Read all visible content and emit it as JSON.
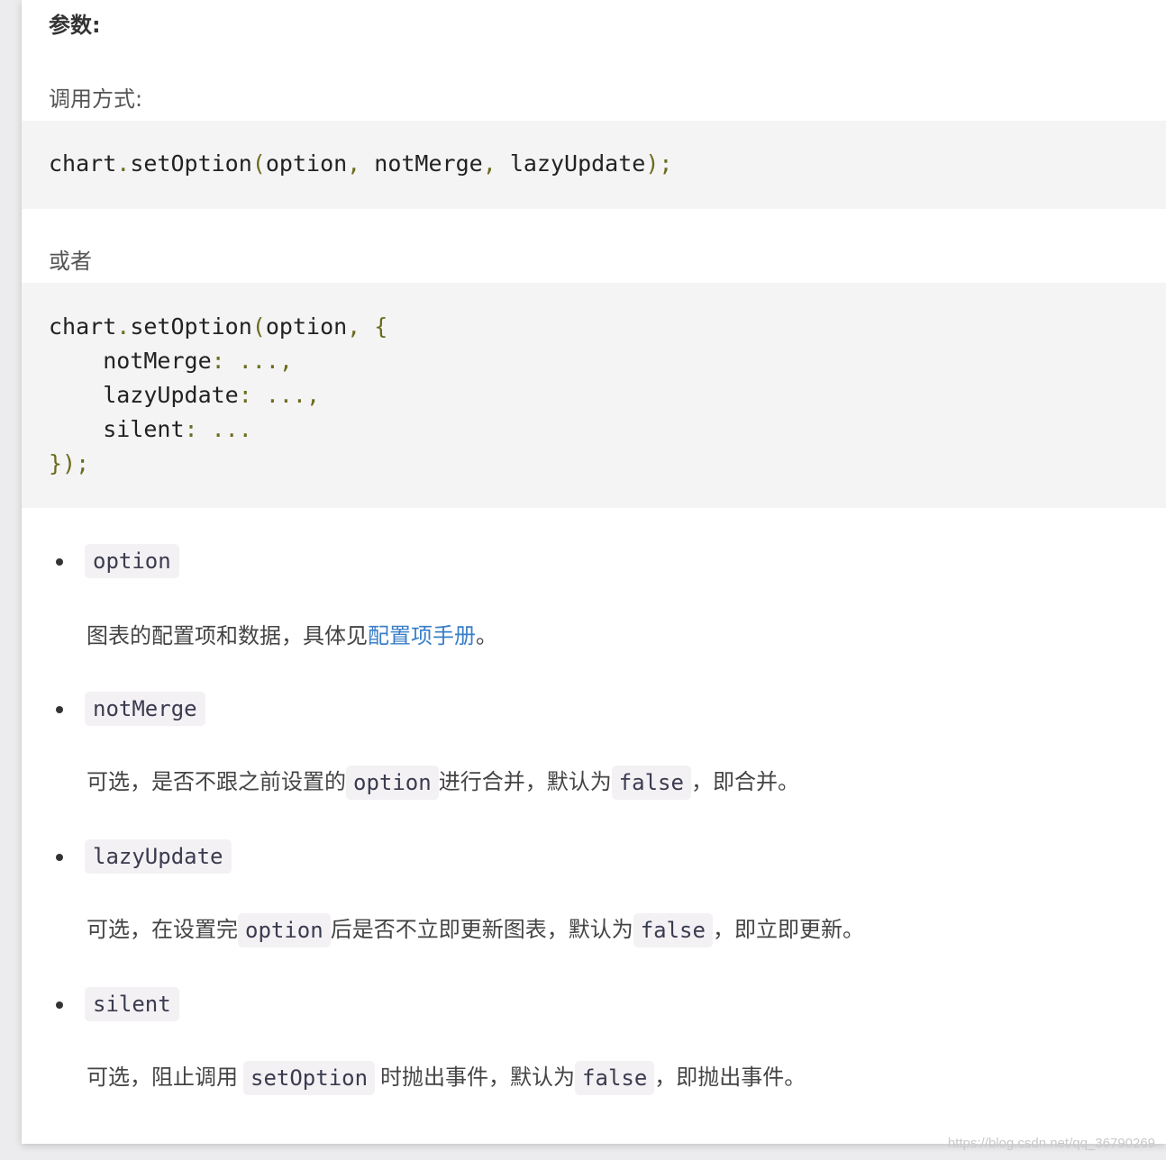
{
  "heading": "参数:",
  "call_intro": "调用方式:",
  "code1": {
    "l1": {
      "a": "chart",
      "b": ".",
      "c": "setOption",
      "d": "(",
      "e": "option",
      "f": ", ",
      "g": "notMerge",
      "h": ", ",
      "i": "lazyUpdate",
      "j": ");"
    }
  },
  "or_text": "或者",
  "code2": {
    "l1": {
      "a": "chart",
      "b": ".",
      "c": "setOption",
      "d": "(",
      "e": "option",
      "f": ", {"
    },
    "l2": {
      "k": "    notMerge",
      "p": ": ...,"
    },
    "l3": {
      "k": "    lazyUpdate",
      "p": ": ...,"
    },
    "l4": {
      "k": "    silent",
      "p": ": ..."
    },
    "l5": {
      "p": "});"
    }
  },
  "params": [
    {
      "name": "option",
      "desc": {
        "a": "图表的配置项和数据，具体见",
        "link": "配置项手册",
        "b": "。"
      }
    },
    {
      "name": "notMerge",
      "desc": {
        "a": "可选，是否不跟之前设置的",
        "c1": "option",
        "b": "进行合并，默认为",
        "c2": "false",
        "d": "，即合并。"
      }
    },
    {
      "name": "lazyUpdate",
      "desc": {
        "a": "可选，在设置完",
        "c1": "option",
        "b": "后是否不立即更新图表，默认为",
        "c2": "false",
        "d": "，即立即更新。"
      }
    },
    {
      "name": "silent",
      "desc": {
        "a": "可选，阻止调用",
        "c1": "setOption",
        "b": "时抛出事件，默认为",
        "c2": "false",
        "d": "，即抛出事件。"
      }
    }
  ],
  "watermark": "https://blog.csdn.net/qq_36790269"
}
